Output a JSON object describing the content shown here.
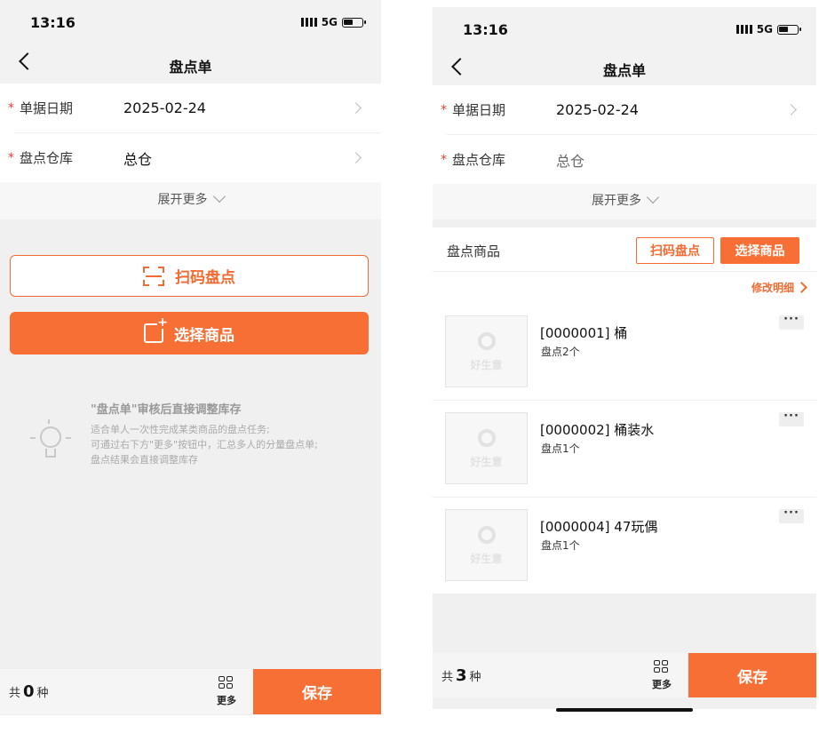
{
  "status": {
    "time": "13:16",
    "network": "5G"
  },
  "nav": {
    "title": "盘点单"
  },
  "form": {
    "date_label": "单据日期",
    "date_value": "2025-02-24",
    "warehouse_label": "盘点仓库",
    "warehouse_value": "总仓",
    "required_mark": "*"
  },
  "expand_label": "展开更多",
  "left": {
    "scan_button": "扫码盘点",
    "select_button": "选择商品",
    "tips": {
      "title": "\"盘点单\"审核后直接调整库存",
      "lines": [
        "适合单人一次性完成某类商品的盘点任务;",
        "可通过右下方\"更多\"按钮中，汇总多人的分量盘点单;",
        "盘点结果会直接调整库存"
      ]
    },
    "bottom": {
      "total_prefix": "共",
      "total_count": "0",
      "total_suffix": "种",
      "more_label": "更多",
      "save_label": "保存"
    }
  },
  "right": {
    "section_title": "盘点商品",
    "scan_button": "扫码盘点",
    "select_button": "选择商品",
    "edit_detail": "修改明细",
    "thumb_logo_text": "好生意",
    "items": [
      {
        "name": "[0000001] 桶",
        "qty": "盘点2个"
      },
      {
        "name": "[0000002] 桶装水",
        "qty": "盘点1个"
      },
      {
        "name": "[0000004] 47玩偶",
        "qty": "盘点1个"
      }
    ],
    "bottom": {
      "total_prefix": "共",
      "total_count": "3",
      "total_suffix": "种",
      "more_label": "更多",
      "save_label": "保存"
    }
  },
  "colors": {
    "accent": "#f76f34",
    "required": "#e8403a"
  }
}
